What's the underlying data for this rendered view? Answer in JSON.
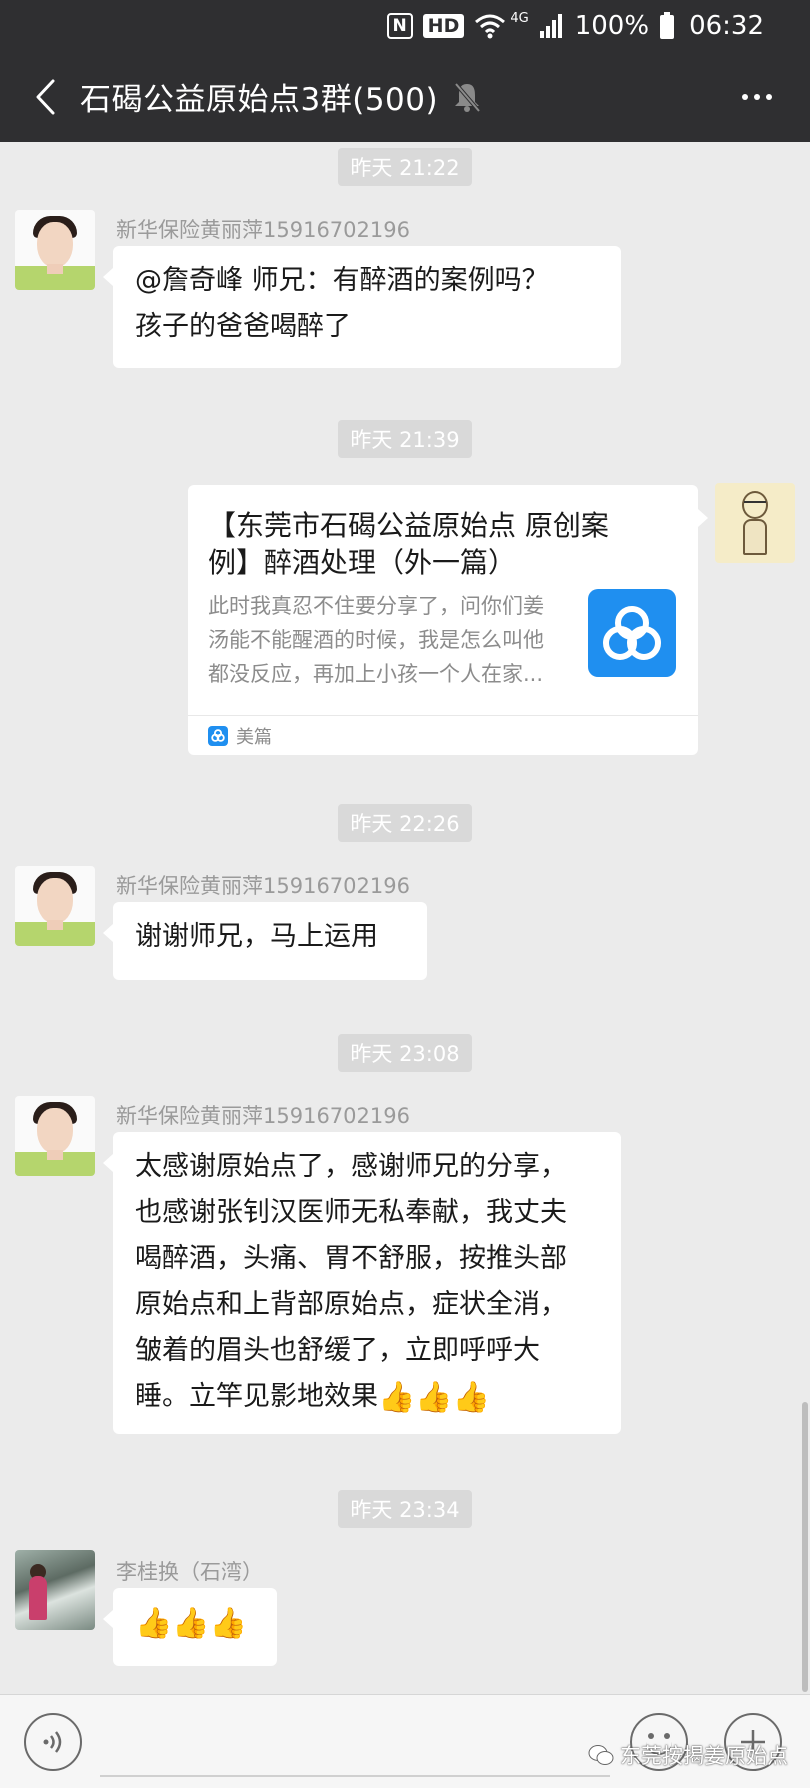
{
  "status_bar": {
    "nfc": "N",
    "hd": "HD",
    "network": "4G",
    "battery_percent": "100%",
    "time": "06:32"
  },
  "header": {
    "title": "石碣公益原始点3群(500)",
    "back_icon": "chevron-left-icon",
    "mute_icon": "bell-off-icon",
    "more_icon": "more-dots-icon"
  },
  "messages": [
    {
      "time": "昨天 21:22",
      "sender": "新华保险黄丽萍15916702196",
      "lines": [
        "@詹奇峰  师兄：有醉酒的案例吗？",
        "孩子的爸爸喝醉了"
      ]
    },
    {
      "time": "昨天 21:39",
      "link_card": {
        "title_lines": [
          "【东莞市石碣公益原始点 原创案",
          "例】醉酒处理（外一篇）"
        ],
        "desc_lines": [
          "此时我真忍不住要分享了，问你们姜",
          "汤能不能醒酒的时候，我是怎么叫他",
          "都没反应，再加上小孩一个人在家..."
        ],
        "source": "美篇"
      }
    },
    {
      "time": "昨天 22:26",
      "sender": "新华保险黄丽萍15916702196",
      "lines": [
        "谢谢师兄，马上运用"
      ]
    },
    {
      "time": "昨天 23:08",
      "sender": "新华保险黄丽萍15916702196",
      "lines": [
        "太感谢原始点了，感谢师兄的分享，",
        "也感谢张钊汉医师无私奉献，我丈夫",
        "喝醉酒，头痛、胃不舒服，按推头部",
        "原始点和上背部原始点，症状全消，",
        "皱着的眉头也舒缓了，立即呼呼大",
        "睡。立竿见影地效果"
      ],
      "emoji": "👍👍👍"
    },
    {
      "time": "昨天 23:34",
      "sender": "李桂换（石湾）",
      "emoji": "👍👍👍"
    }
  ],
  "input_bar": {
    "voice_icon": "voice-icon",
    "emoji_icon": "emoji-icon",
    "plus_icon": "plus-icon"
  },
  "watermark": "东莞按揭姜原始点",
  "colors": {
    "header_bg": "#2f2f31",
    "chat_bg": "#ebebeb",
    "bubble": "#ffffff",
    "time_pill": "#d9d9d9",
    "meipian_blue": "#1f8ff0"
  }
}
